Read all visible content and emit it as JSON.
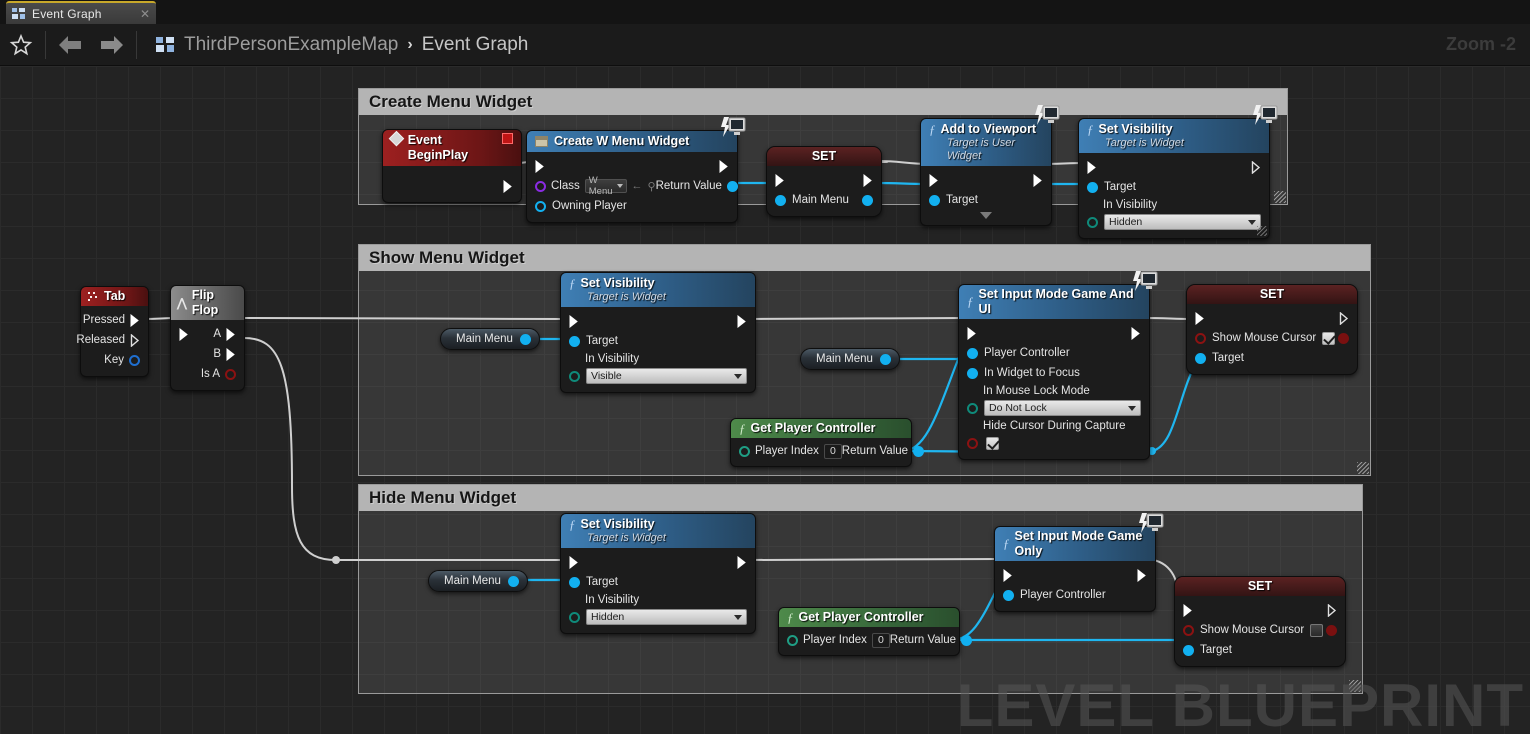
{
  "window": {
    "tab": {
      "label": "Event Graph",
      "icon": "blueprint-icon",
      "close_icon": "close-icon"
    }
  },
  "toolbar": {
    "favorite_icon": "star-icon",
    "back_icon": "back-arrow-icon",
    "forward_icon": "forward-arrow-icon",
    "breadcrumb_icon": "blueprint-icon",
    "breadcrumb_root": "ThirdPersonExampleMap",
    "breadcrumb_sep": "›",
    "breadcrumb_current": "Event Graph",
    "zoom_label": "Zoom -2"
  },
  "canvas": {
    "watermark": "LEVEL BLUEPRINT"
  },
  "comments": [
    {
      "title": "Create Menu Widget"
    },
    {
      "title": "Show Menu Widget"
    },
    {
      "title": "Hide Menu Widget"
    }
  ],
  "nodes": {
    "event_begin_play": {
      "title": "Event BeginPlay"
    },
    "create_w_menu_widget": {
      "title": "Create W Menu Widget",
      "class_label": "Class",
      "class_value": "W Menu",
      "owning_player_label": "Owning Player",
      "return_label": "Return Value"
    },
    "set_main_menu": {
      "title": "SET",
      "pin_label": "Main Menu"
    },
    "add_to_viewport": {
      "title": "Add to Viewport",
      "subtitle": "Target is User Widget",
      "target_label": "Target"
    },
    "set_visibility_hidden_top": {
      "title": "Set Visibility",
      "subtitle": "Target is Widget",
      "target_label": "Target",
      "in_visibility_label": "In Visibility",
      "in_visibility_value": "Hidden"
    },
    "tab_key_event": {
      "title": "Tab",
      "pressed_label": "Pressed",
      "released_label": "Released",
      "key_label": "Key"
    },
    "flip_flop": {
      "title": "Flip Flop",
      "a_label": "A",
      "b_label": "B",
      "is_a_label": "Is A"
    },
    "main_menu_show": {
      "label": "Main Menu"
    },
    "set_visibility_visible": {
      "title": "Set Visibility",
      "subtitle": "Target is Widget",
      "target_label": "Target",
      "in_visibility_label": "In Visibility",
      "in_visibility_value": "Visible"
    },
    "main_menu_focus": {
      "label": "Main Menu"
    },
    "get_player_controller_show": {
      "title": "Get Player Controller",
      "player_index_label": "Player Index",
      "player_index_value": "0",
      "return_label": "Return Value"
    },
    "set_input_mode_game_and_ui": {
      "title": "Set Input Mode Game And UI",
      "player_controller_label": "Player Controller",
      "in_widget_to_focus_label": "In Widget to Focus",
      "in_mouse_lock_mode_label": "In Mouse Lock Mode",
      "in_mouse_lock_mode_value": "Do Not Lock",
      "hide_cursor_label": "Hide Cursor During Capture",
      "hide_cursor_checked": true
    },
    "set_show_mouse_cursor_true": {
      "title": "SET",
      "show_mouse_cursor_label": "Show Mouse Cursor",
      "show_mouse_cursor_checked": true,
      "target_label": "Target"
    },
    "main_menu_hide": {
      "label": "Main Menu"
    },
    "set_visibility_hidden_bottom": {
      "title": "Set Visibility",
      "subtitle": "Target is Widget",
      "target_label": "Target",
      "in_visibility_label": "In Visibility",
      "in_visibility_value": "Hidden"
    },
    "get_player_controller_hide": {
      "title": "Get Player Controller",
      "player_index_label": "Player Index",
      "player_index_value": "0",
      "return_label": "Return Value"
    },
    "set_input_mode_game_only": {
      "title": "Set Input Mode Game Only",
      "player_controller_label": "Player Controller"
    },
    "set_show_mouse_cursor_false": {
      "title": "SET",
      "show_mouse_cursor_label": "Show Mouse Cursor",
      "show_mouse_cursor_checked": false,
      "target_label": "Target"
    }
  },
  "colors": {
    "exec_wire": "#cfcfcf",
    "object_wire": "#1fb6f0",
    "accent_blue": "#12b0f0",
    "event_red": "#9d2020",
    "pure_green": "#4e8a4a",
    "comment_header": "#b4b4b4"
  }
}
